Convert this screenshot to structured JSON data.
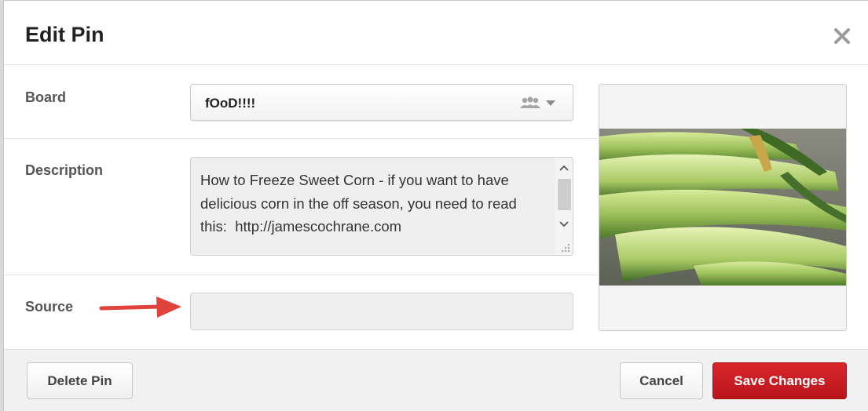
{
  "dialog": {
    "title": "Edit Pin"
  },
  "board": {
    "label": "Board",
    "selected": "fOoD!!!!"
  },
  "description": {
    "label": "Description",
    "value": "How to Freeze Sweet Corn - if you want to have delicious corn in the off season, you need to read this:  http://jamescochrane.com"
  },
  "source": {
    "label": "Source",
    "value": ""
  },
  "footer": {
    "delete_label": "Delete Pin",
    "cancel_label": "Cancel",
    "save_label": "Save Changes"
  },
  "colors": {
    "save_button": "#c8191f",
    "annotation_arrow": "#e0423c"
  },
  "icons": {
    "close": "close-icon",
    "group": "group-board-icon",
    "caret": "chevron-down-icon"
  }
}
